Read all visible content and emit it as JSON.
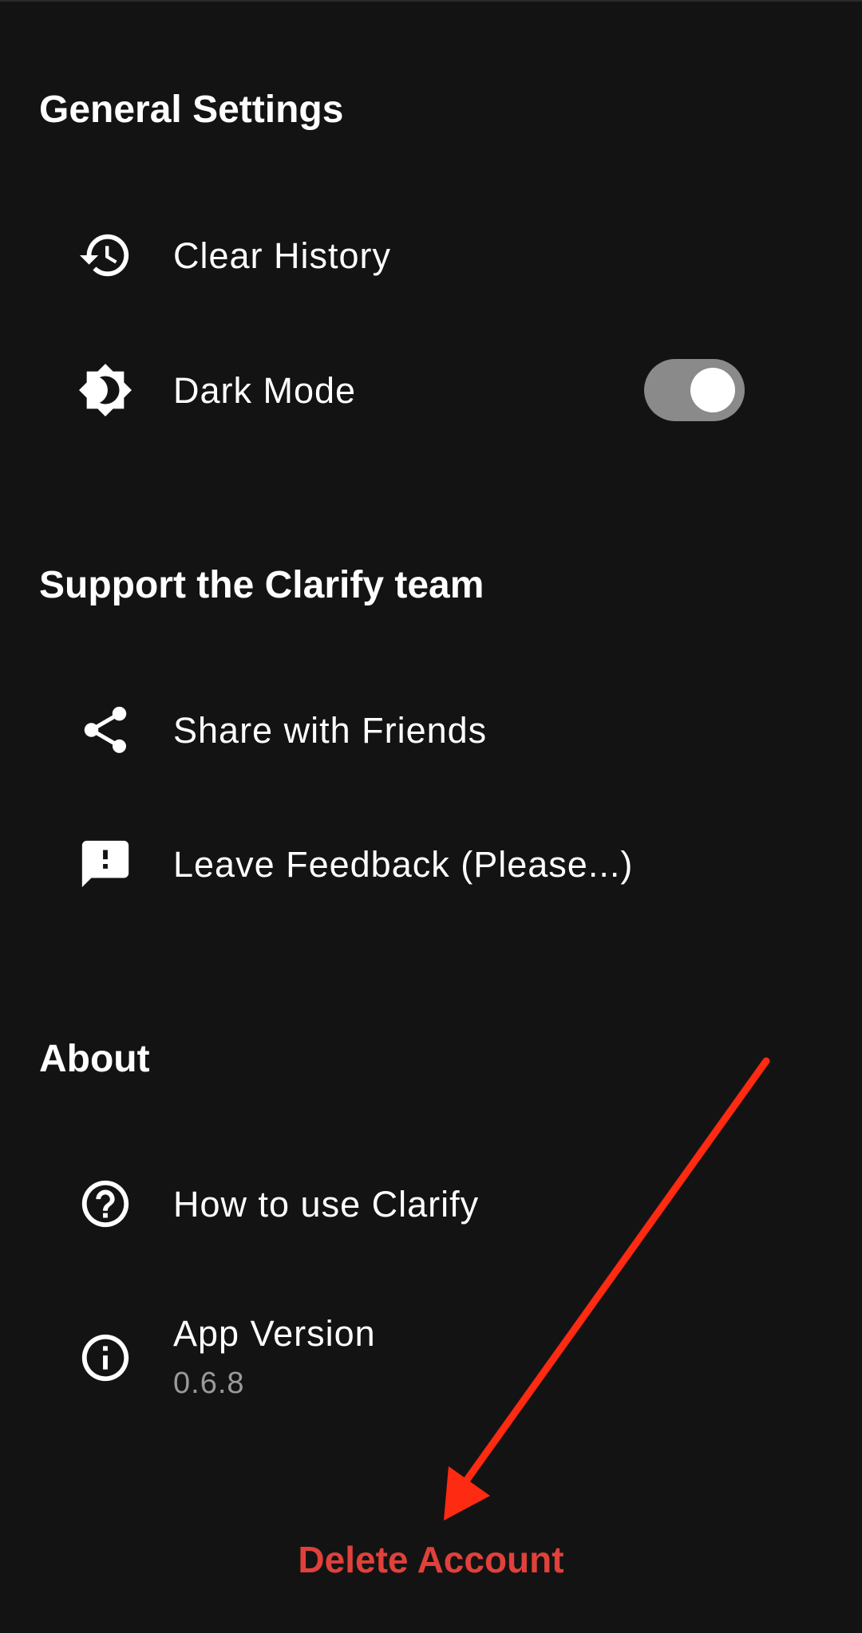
{
  "sections": {
    "general": {
      "title": "General Settings",
      "items": [
        {
          "label": "Clear History",
          "icon": "history-icon"
        },
        {
          "label": "Dark Mode",
          "icon": "brightness-icon",
          "toggle_on": true
        }
      ]
    },
    "support": {
      "title": "Support the Clarify team",
      "items": [
        {
          "label": "Share with Friends",
          "icon": "share-icon"
        },
        {
          "label": "Leave Feedback (Please...)",
          "icon": "feedback-icon"
        }
      ]
    },
    "about": {
      "title": "About",
      "items": [
        {
          "label": "How to use Clarify",
          "icon": "help-circle-icon"
        },
        {
          "label": "App Version",
          "value": "0.6.8",
          "icon": "info-icon"
        }
      ]
    }
  },
  "delete_account_label": "Delete Account",
  "colors": {
    "background": "#141314",
    "text": "#ffffff",
    "secondary_text": "#9a9a9a",
    "danger": "#e0413a",
    "annotation_arrow": "#ff2a12",
    "toggle_track": "#8a8a8a"
  }
}
